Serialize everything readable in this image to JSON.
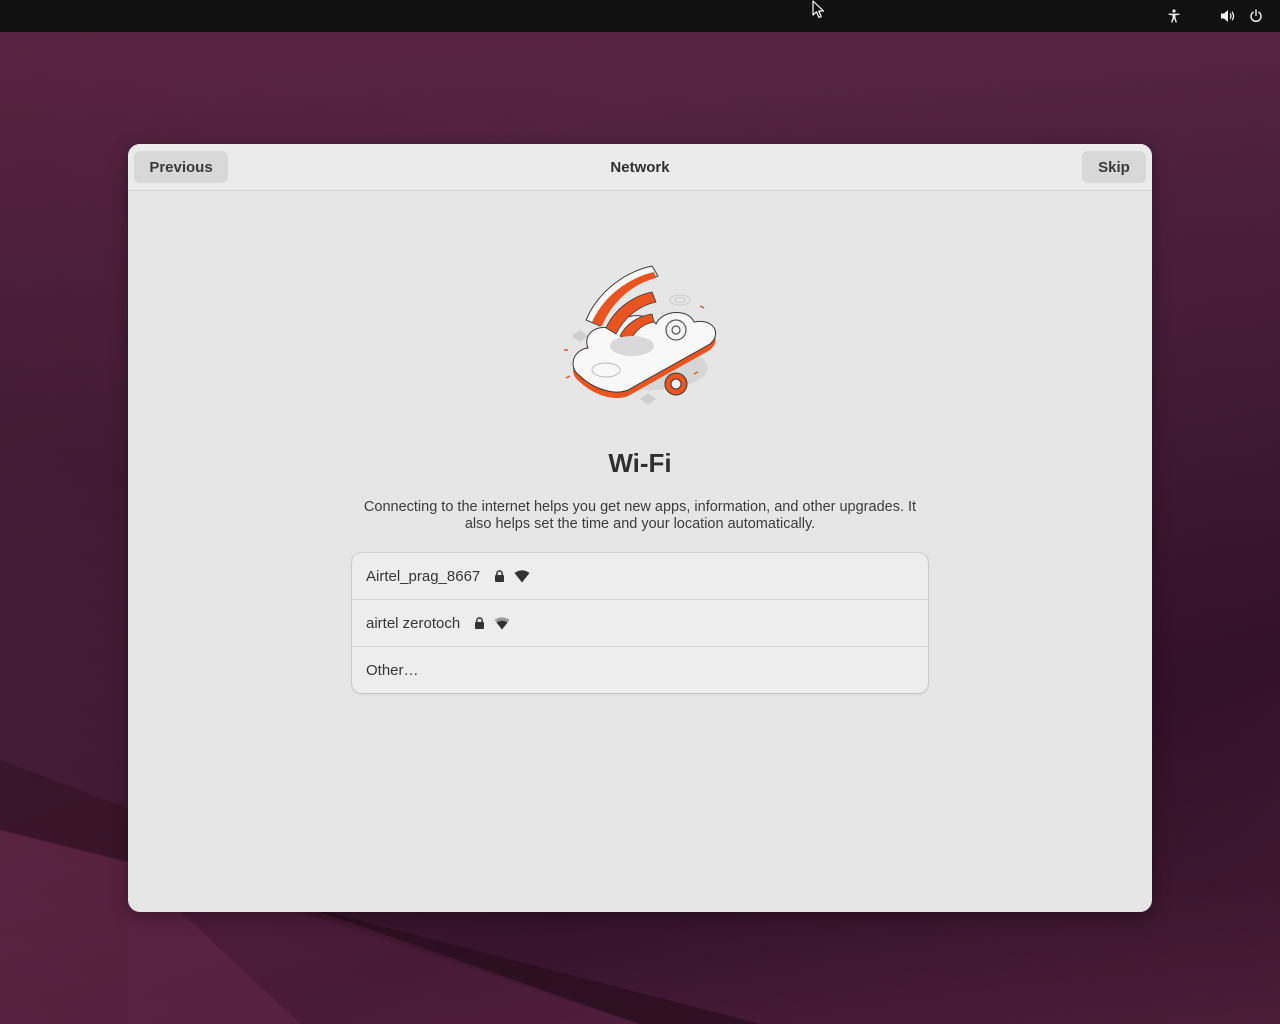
{
  "topbar": {
    "icons": [
      "accessibility-icon",
      "volume-icon",
      "power-icon"
    ]
  },
  "window": {
    "header": {
      "previous_label": "Previous",
      "title": "Network",
      "skip_label": "Skip"
    },
    "heading": "Wi-Fi",
    "description": "Connecting to the internet helps you get new apps, information, and other upgrades. It also helps set the time and your location automatically.",
    "networks": [
      {
        "ssid": "Airtel_prag_8667",
        "secured": true,
        "signal_icon": "wifi-signal-full-icon"
      },
      {
        "ssid": "airtel zerotoch",
        "secured": true,
        "signal_icon": "wifi-signal-good-icon"
      }
    ],
    "other_label": "Other…"
  },
  "colors": {
    "accent": "#e95420",
    "topbar_bg": "#111111",
    "window_bg": "#e6e6e6"
  }
}
